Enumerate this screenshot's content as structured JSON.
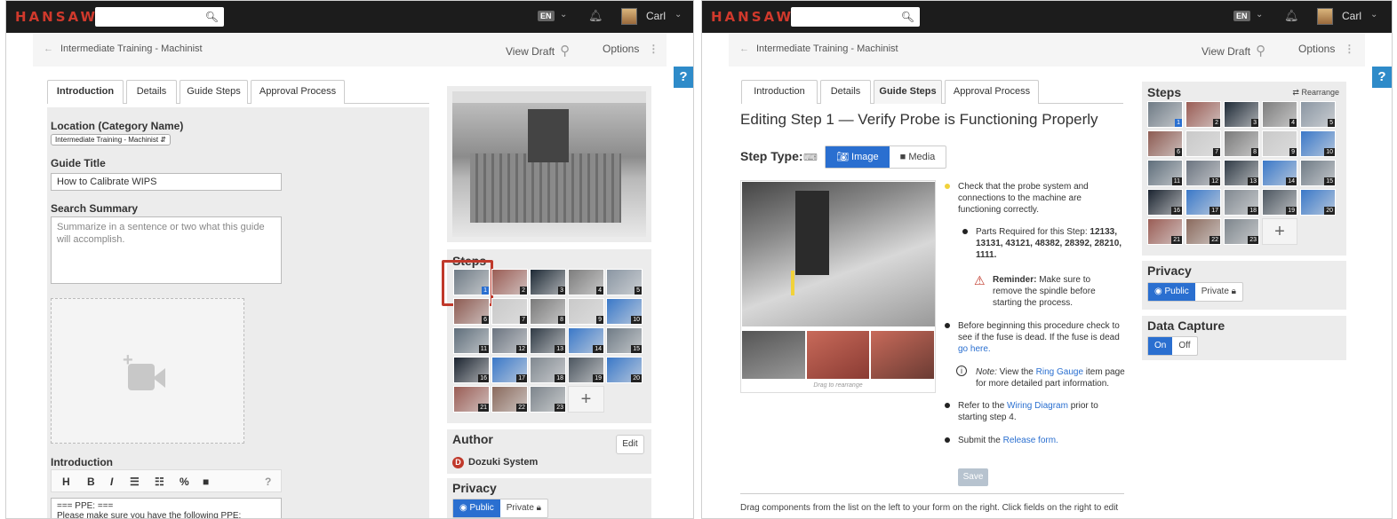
{
  "brand": "HANSAW",
  "colors": {
    "accent": "#2a6fd0",
    "topbar": "#1c1c1c",
    "logo": "#d0392c",
    "highlight": "#c0392b"
  },
  "topbar": {
    "lang": "EN",
    "user": "Carl",
    "search_icon": "search-icon",
    "bell_icon": "bell-icon"
  },
  "breadcrumb": "Intermediate Training - Machinist",
  "header": {
    "view_draft": "View Draft",
    "options": "Options",
    "help": "?"
  },
  "tabs": [
    "Introduction",
    "Details",
    "Guide Steps",
    "Approval Process"
  ],
  "left": {
    "active_tab": "Introduction",
    "location_label": "Location (Category Name)",
    "location_value": "Intermediate Training - Machinist",
    "guide_title_label": "Guide Title",
    "guide_title_value": "How to Calibrate WIPS",
    "summary_label": "Search Summary",
    "summary_placeholder": "Summarize in a sentence or two what this guide will accomplish.",
    "intro_label": "Introduction",
    "intro_text": "=== PPE: ===",
    "intro_text2": "Please make sure you have the following PPE:",
    "toolbar": [
      "H",
      "B",
      "I",
      "☰",
      "☷",
      "%",
      "■",
      "?"
    ],
    "steps_label": "Steps",
    "author_label": "Author",
    "author_name": "Dozuki System",
    "edit": "Edit",
    "privacy_label": "Privacy",
    "privacy_public": "Public",
    "privacy_private": "Private"
  },
  "right": {
    "active_tab": "Guide Steps",
    "heading": "Editing Step 1 — Verify Probe is Functioning Properly",
    "step_type_label": "Step Type:",
    "type_image": "Image",
    "type_media": "Media",
    "drag_caption": "Drag to rearrange",
    "bullets": [
      {
        "pre": "Check that the probe system and connections to the machine are functioning correctly."
      },
      {
        "pre": "Parts Required for this Step: ",
        "bold": "12133, 13131, 43121, 48382, 28392, 28210, 1111."
      },
      {
        "bold": "Reminder:",
        "post": " Make sure to remove the spindle before starting the process."
      },
      {
        "pre": "Before beginning this procedure check to see if the fuse is dead. If the fuse is dead ",
        "link": "go here."
      },
      {
        "italic": "Note:",
        "pre": " View the ",
        "link": "Ring Gauge",
        "post": " item page for more detailed part information."
      },
      {
        "pre": "Refer to the ",
        "link": "Wiring Diagram",
        "post": " prior to starting step 4."
      },
      {
        "pre": "Submit the ",
        "link": "Release form."
      }
    ],
    "save": "Save",
    "drag_note": "Drag components from the list on the left to your form on the right. Click fields on the right to edit",
    "steps_label": "Steps",
    "rearrange": "Rearrange",
    "privacy_label": "Privacy",
    "privacy_public": "Public",
    "privacy_private": "Private",
    "capture_label": "Data Capture",
    "capture_on": "On",
    "capture_off": "Off"
  },
  "step_numbers": [
    "1",
    "2",
    "3",
    "4",
    "5",
    "6",
    "7",
    "8",
    "9",
    "10",
    "11",
    "12",
    "13",
    "14",
    "15",
    "16",
    "17",
    "18",
    "19",
    "20",
    "21",
    "22",
    "23"
  ]
}
